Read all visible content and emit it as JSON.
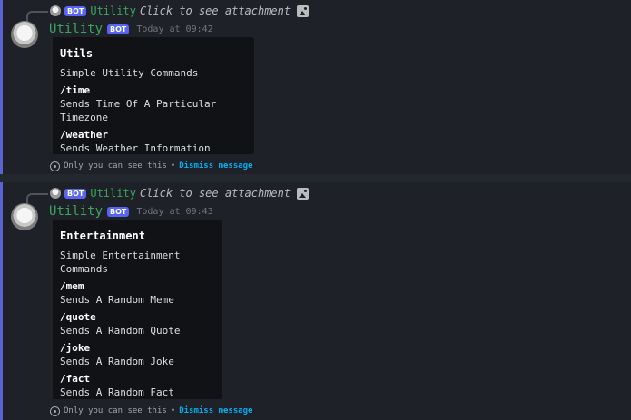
{
  "messages": [
    {
      "reply": {
        "bot_tag": "BOT",
        "name": "Utility",
        "content": "Click to see attachment"
      },
      "author": "Utility",
      "bot_tag": "BOT",
      "timestamp": "Today at 09:42",
      "embed": {
        "title": "Utils",
        "description": "Simple Utility Commands",
        "fields": [
          {
            "name": "/time",
            "value": "Sends Time Of A Particular Timezone"
          },
          {
            "name": "/weather",
            "value": "Sends Weather Information"
          }
        ]
      },
      "ephemeral": {
        "text": "Only you can see this",
        "separator": "•",
        "dismiss": "Dismiss message"
      }
    },
    {
      "reply": {
        "bot_tag": "BOT",
        "name": "Utility",
        "content": "Click to see attachment"
      },
      "author": "Utility",
      "bot_tag": "BOT",
      "timestamp": "Today at 09:43",
      "embed": {
        "title": "Entertainment",
        "description": "Simple Entertainment Commands",
        "fields": [
          {
            "name": "/mem",
            "value": "Sends A Random Meme"
          },
          {
            "name": "/quote",
            "value": "Sends A Random Quote"
          },
          {
            "name": "/joke",
            "value": "Sends A Random Joke"
          },
          {
            "name": "/fact",
            "value": "Sends A Random Fact"
          }
        ]
      },
      "ephemeral": {
        "text": "Only you can see this",
        "separator": "•",
        "dismiss": "Dismiss message"
      }
    }
  ],
  "icons": {
    "attachment": "image-icon",
    "ephemeral": "eye-icon"
  },
  "colors": {
    "background": "#23272e",
    "message_bg": "#1e2127",
    "accent": "#5b63d4",
    "bot_tag": "#5865f2",
    "username": "#3ba55d",
    "link": "#00aff4",
    "embed_bg": "#101216"
  }
}
